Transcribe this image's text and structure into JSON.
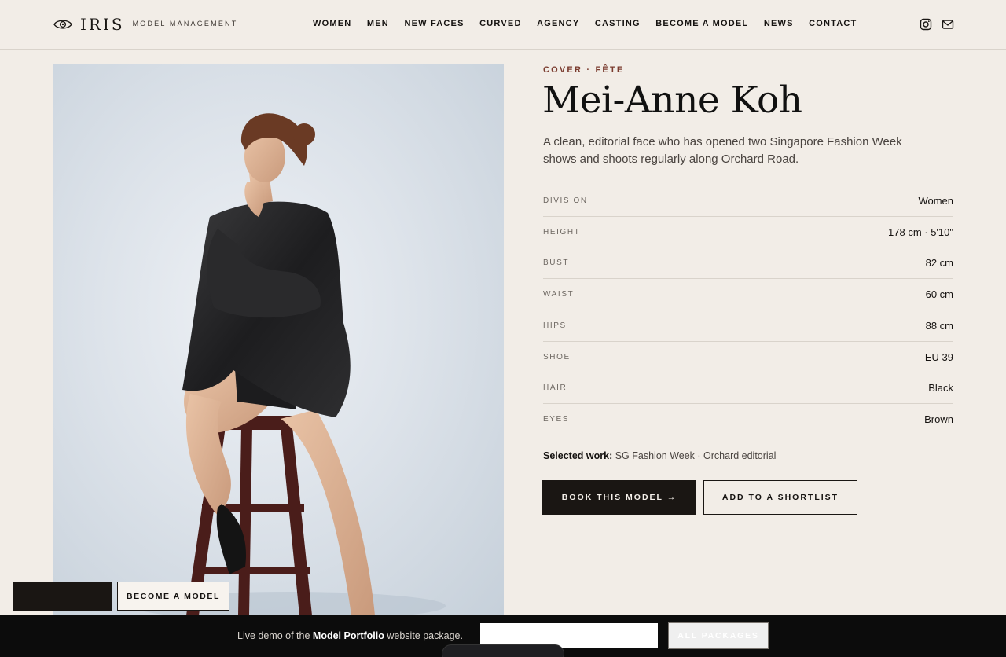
{
  "brand": {
    "name": "IRIS",
    "tagline": "MODEL MANAGEMENT",
    "logo_icon": "eye-icon"
  },
  "nav": {
    "items": [
      {
        "label": "WOMEN"
      },
      {
        "label": "MEN"
      },
      {
        "label": "NEW FACES"
      },
      {
        "label": "CURVED"
      },
      {
        "label": "AGENCY"
      },
      {
        "label": "CASTING"
      },
      {
        "label": "BECOME A MODEL"
      },
      {
        "label": "NEWS"
      },
      {
        "label": "CONTACT"
      }
    ]
  },
  "social": {
    "icons": [
      "instagram-icon",
      "mail-icon"
    ]
  },
  "profile": {
    "eyebrow": "COVER · FÊTE",
    "name": "Mei-Anne Koh",
    "bio": "A clean, editorial face who has opened two Singapore Fashion Week shows and shoots regularly along Orchard Road.",
    "stats": [
      {
        "label": "DIVISION",
        "value": "Women"
      },
      {
        "label": "HEIGHT",
        "value": "178 cm · 5'10\""
      },
      {
        "label": "BUST",
        "value": "82 cm"
      },
      {
        "label": "WAIST",
        "value": "60 cm"
      },
      {
        "label": "HIPS",
        "value": "88 cm"
      },
      {
        "label": "SHOE",
        "value": "EU 39"
      },
      {
        "label": "HAIR",
        "value": "Black"
      },
      {
        "label": "EYES",
        "value": "Brown"
      }
    ],
    "selected_work_label": "Selected work:",
    "selected_work_value": "SG Fashion Week · Orchard editorial",
    "book_button": "BOOK THIS MODEL →",
    "shortlist_button": "ADD TO A SHORTLIST"
  },
  "floating": {
    "become_model": "BECOME A MODEL"
  },
  "demo_bar": {
    "text_prefix": "Live demo of the",
    "text_bold": "Model Portfolio",
    "text_suffix": "website package.",
    "packages_button": "ALL PACKAGES"
  },
  "colors": {
    "background": "#f2ede7",
    "accent": "#7a3b2e",
    "dark": "#1a1613"
  }
}
